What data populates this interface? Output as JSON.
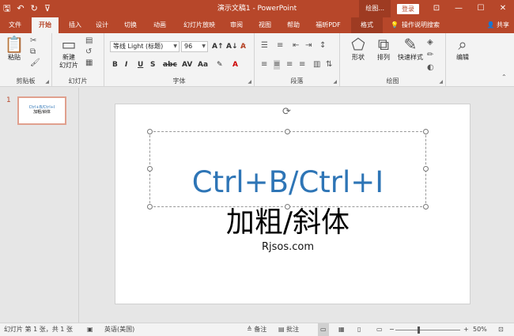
{
  "title_bar": {
    "title": "演示文稿1 - PowerPoint",
    "drawing_tools": "绘图...",
    "login": "登录",
    "qat": {
      "save_icon": "save-icon",
      "undo_icon": "undo-icon",
      "redo_icon": "redo-icon"
    }
  },
  "tabs": {
    "file": "文件",
    "home": "开始",
    "insert": "插入",
    "design": "设计",
    "transitions": "切换",
    "animations": "动画",
    "slideshow": "幻灯片放映",
    "review": "审阅",
    "view": "视图",
    "help": "帮助",
    "foxit": "福昕PDF",
    "format": "格式",
    "tell_me": "操作说明搜索",
    "share": "共享"
  },
  "ribbon": {
    "clipboard": {
      "label": "剪贴板",
      "paste": "粘贴"
    },
    "slides": {
      "label": "幻灯片",
      "new_slide_1": "新建",
      "new_slide_2": "幻灯片"
    },
    "font": {
      "label": "字体",
      "font_name": "等线 Light (标题)",
      "font_size": "96"
    },
    "paragraph": {
      "label": "段落"
    },
    "drawing": {
      "label": "绘图",
      "shapes": "形状",
      "arrange": "排列",
      "quick_styles": "快速样式"
    },
    "editing": {
      "label": "编辑"
    }
  },
  "thumbnail": {
    "number": "1",
    "line1": "Ctrl+B/Ctrl+I",
    "line2": "加粗/斜体"
  },
  "slide": {
    "main": "Ctrl+B/Ctrl+I",
    "sub": "加粗/斜体",
    "site": "Rjsos.com"
  },
  "status": {
    "slide_info": "幻灯片 第 1 张，共 1 张",
    "language": "英语(美国)",
    "notes": "备注",
    "comments": "批注",
    "zoom": "50%"
  },
  "colors": {
    "accent": "#b7472a",
    "title_text": "#2e75b6"
  }
}
